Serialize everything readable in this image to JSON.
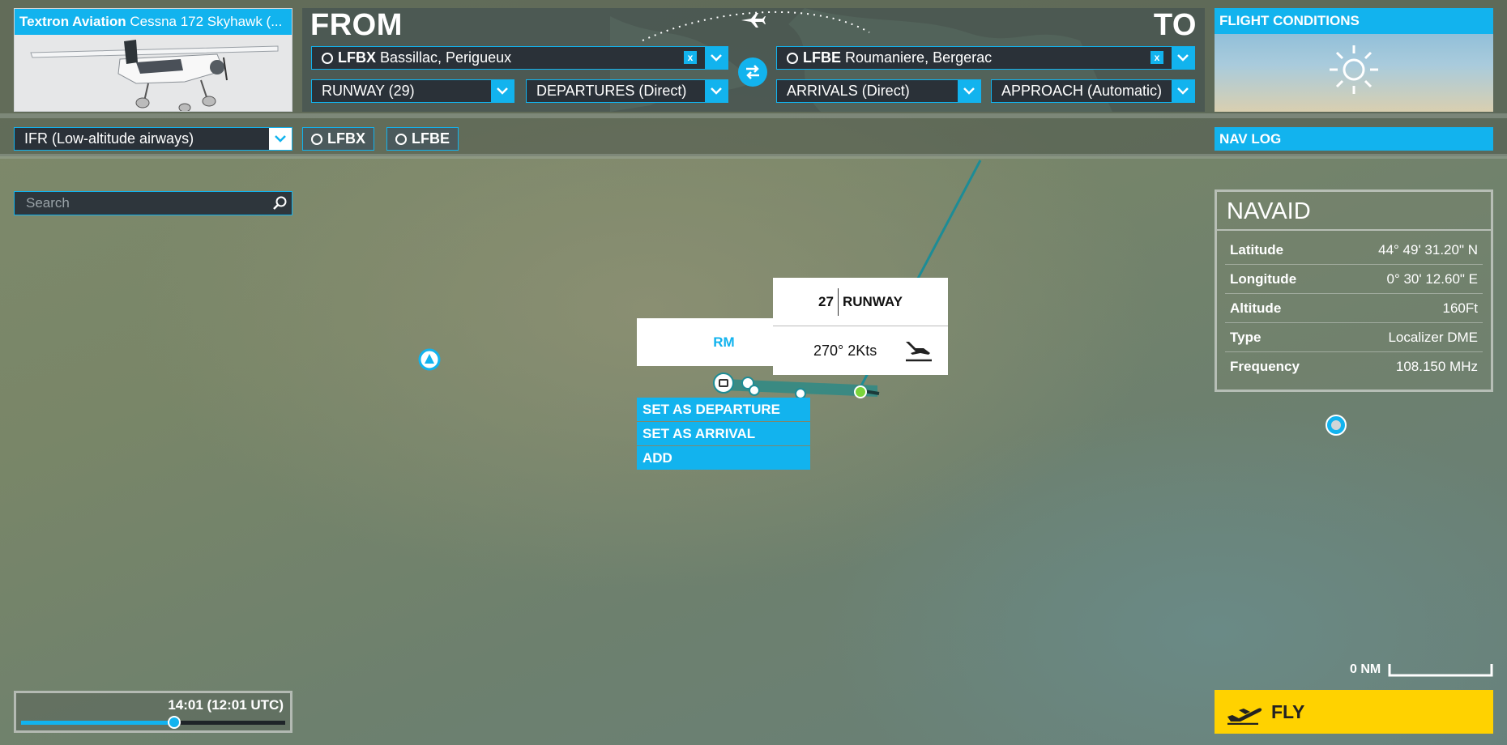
{
  "aircraft": {
    "brand": "Textron Aviation",
    "model": "Cessna 172 Skyhawk (..."
  },
  "route": {
    "from_label": "FROM",
    "to_label": "TO",
    "departure": {
      "code": "LFBX",
      "name": "Bassillac, Perigueux"
    },
    "arrival": {
      "code": "LFBE",
      "name": "Roumaniere, Bergerac"
    },
    "clear_glyph": "x",
    "runway": "RUNWAY (29)",
    "departures": "DEPARTURES (Direct)",
    "arrivals": "ARRIVALS (Direct)",
    "approach": "APPROACH (Automatic)"
  },
  "flight_conditions": {
    "title": "FLIGHT CONDITIONS",
    "icon": "sun-icon"
  },
  "flight_type": "IFR (Low-altitude airways)",
  "waypoint_chips": [
    "LFBX",
    "LFBE"
  ],
  "nav_log": "NAV LOG",
  "search": {
    "placeholder": "Search"
  },
  "navaid": {
    "title": "NAVAID",
    "rows": [
      {
        "label": "Latitude",
        "value": "44° 49' 31.20\" N"
      },
      {
        "label": "Longitude",
        "value": "0° 30' 12.60\" E"
      },
      {
        "label": "Altitude",
        "value": "160Ft"
      },
      {
        "label": "Type",
        "value": "Localizer DME"
      },
      {
        "label": "Frequency",
        "value": "108.150 MHz"
      }
    ]
  },
  "map": {
    "rm_label": "RM",
    "runway_number": "27",
    "runway_label": "RUNWAY",
    "wind": "270° 2Kts",
    "context_menu": [
      "SET AS DEPARTURE",
      "SET AS ARRIVAL",
      "ADD"
    ],
    "scale": "0 NM"
  },
  "time": {
    "label": "14:01 (12:01 UTC)",
    "slider_fraction": 0.58
  },
  "fly_button": "FLY",
  "colors": {
    "accent": "#12b3ee",
    "fly": "#ffd200"
  }
}
